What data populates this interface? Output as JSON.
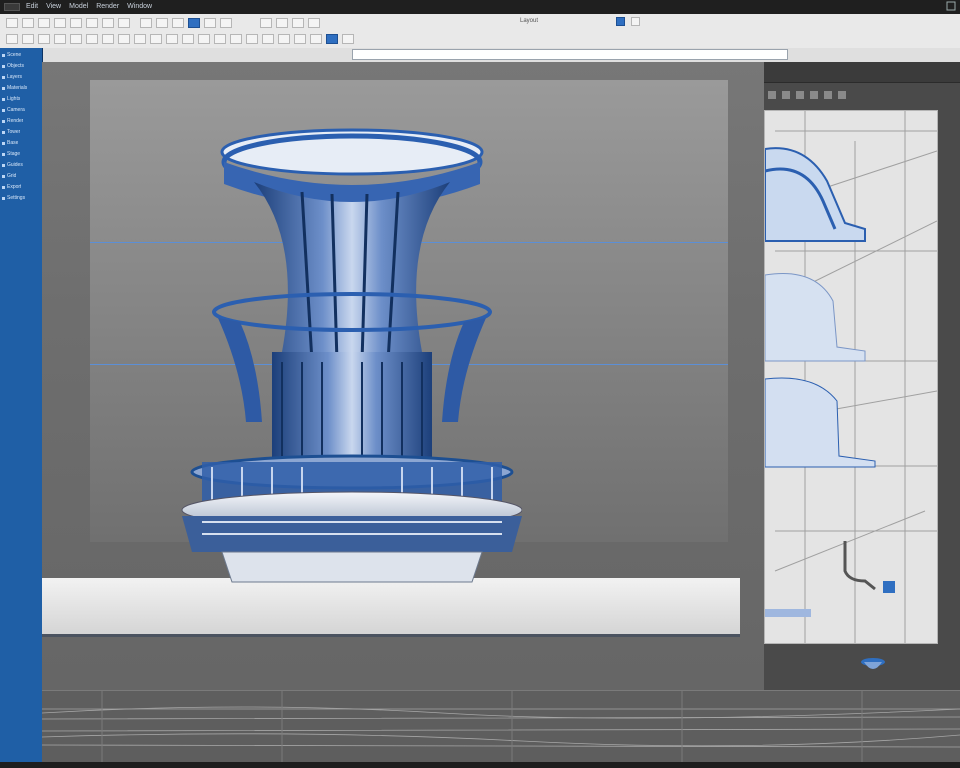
{
  "titlebar": {
    "tabs": [
      "Edit",
      "View",
      "Model",
      "Render",
      "Window"
    ]
  },
  "ribbon": {
    "groups": [
      [
        "tool",
        "tool",
        "tool",
        "tool",
        "tool"
      ],
      [
        "tool",
        "tool",
        "tool",
        "tool"
      ]
    ],
    "layout_select": "Layout"
  },
  "viewbar": {
    "address": ""
  },
  "leftpanel": {
    "items": [
      "Scene",
      "Objects",
      "Layers",
      "Materials",
      "Lights",
      "Camera",
      "Render",
      "Tower",
      "Base",
      "Stage",
      "Guides",
      "Grid",
      "Export",
      "Settings"
    ]
  },
  "sidepanel": {
    "title": ""
  },
  "colors": {
    "accent": "#2f6fc1",
    "panel": "#1f5fa6",
    "model_blue": "#2b5fb0"
  },
  "icons": [
    "app-menu-icon",
    "view-icon",
    "settings-icon",
    "pin-icon"
  ]
}
